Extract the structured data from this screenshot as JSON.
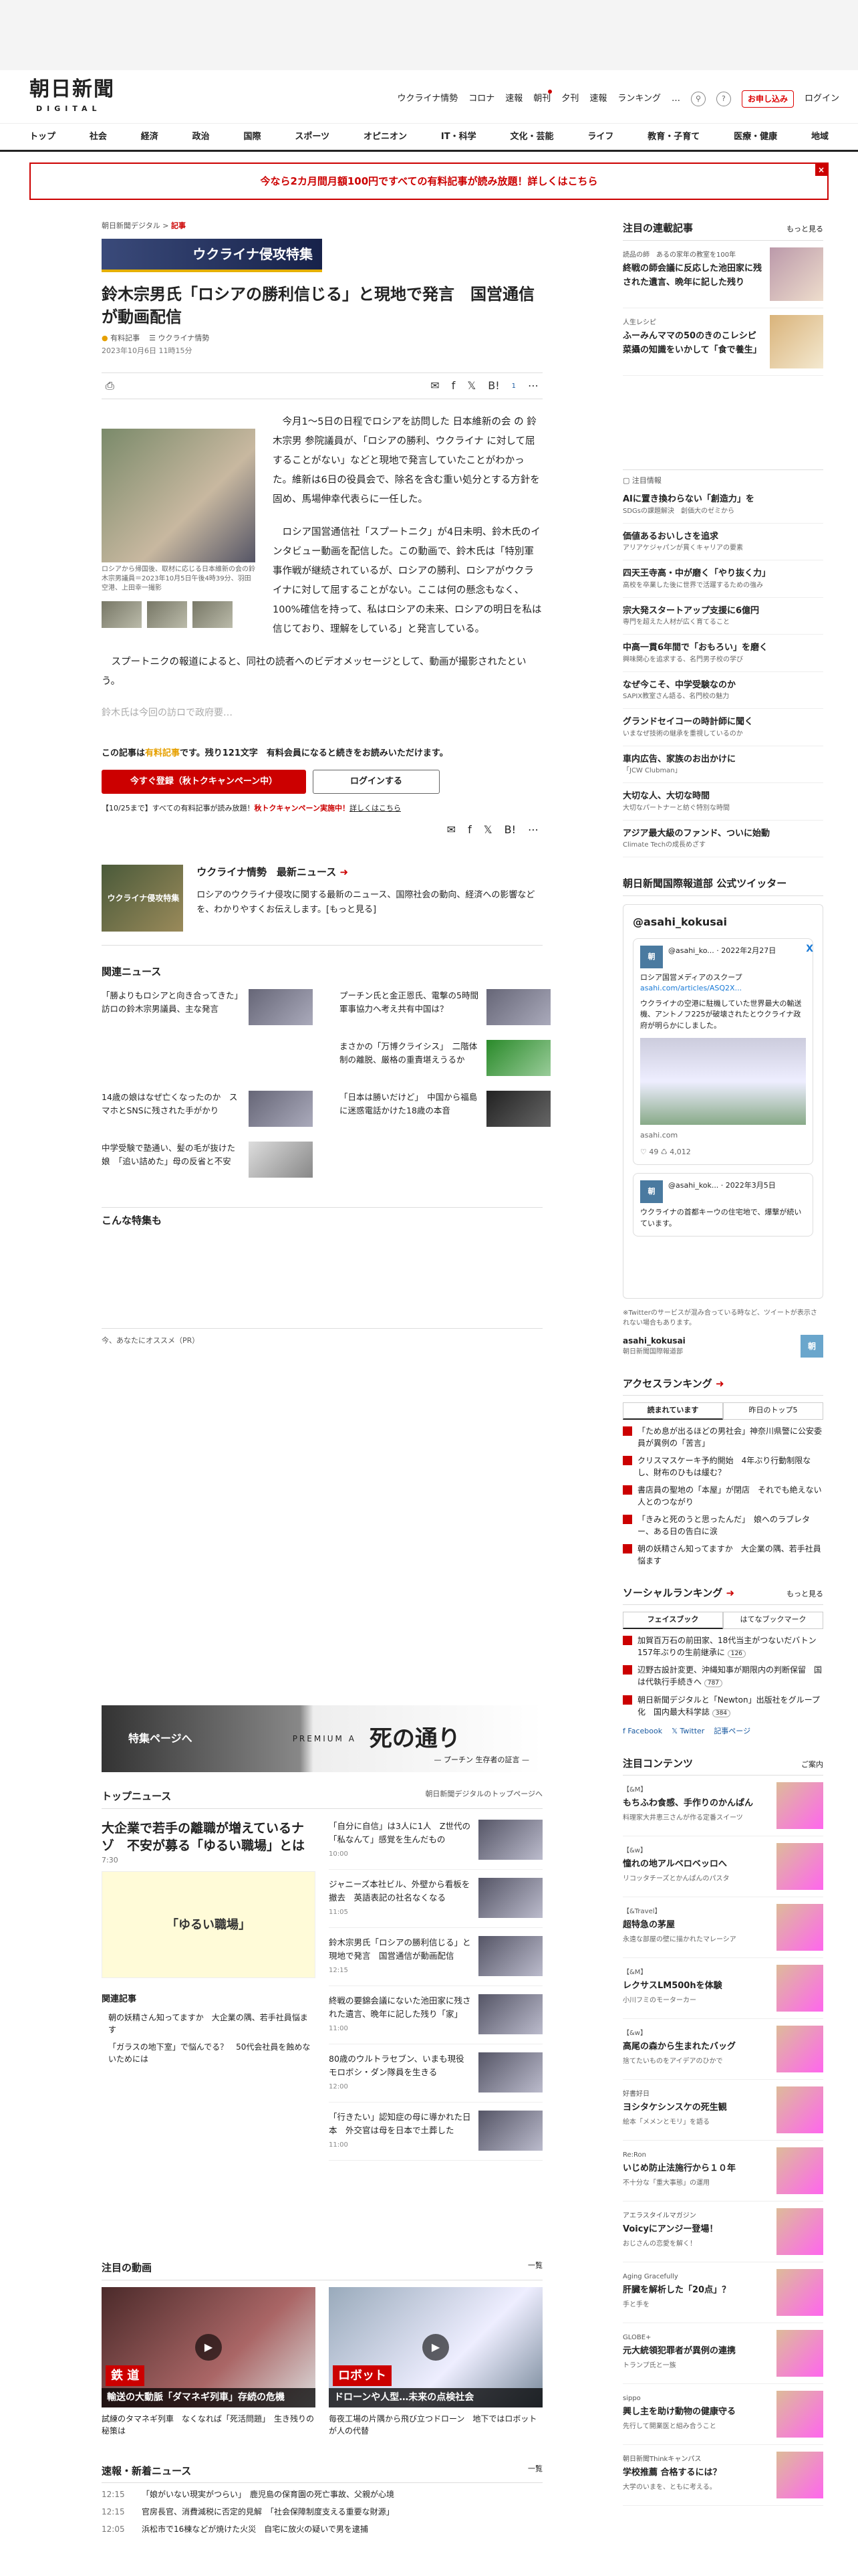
{
  "header": {
    "logo": "朝日新聞",
    "logo_sub": "DIGITAL",
    "nav": [
      "ウクライナ情勢",
      "コロナ",
      "速報",
      "朝刊",
      "夕刊",
      "速報",
      "ランキング"
    ],
    "more": "…",
    "signup": "お申し込み",
    "login": "ログイン"
  },
  "gnav": [
    "トップ",
    "社会",
    "経済",
    "政治",
    "国際",
    "スポーツ",
    "オピニオン",
    "IT・科学",
    "文化・芸能",
    "ライフ",
    "教育・子育て",
    "医療・健康",
    "地域"
  ],
  "banner": {
    "text": "今なら2カ月間月額100円ですべての有料記事が読み放題！詳しくはこちら",
    "close": "×"
  },
  "article": {
    "crumb_site": "朝日新聞デジタル",
    "crumb_sep": ">",
    "crumb_cat": "記事",
    "feature": "ウクライナ侵攻特集",
    "title": "鈴木宗男氏「ロシアの勝利信じる」と現地で発言　国営通信が動画配信",
    "paid": "有料記事",
    "series": "ウクライナ情勢",
    "date": "2023年10月6日 11時15分",
    "share_count": "1",
    "photo_caption": "ロシアから帰国後、取材に応じる日本維新の会の鈴木宗男議員＝2023年10月5日午後4時39分、羽田空港、上田幸一撮影",
    "paras": [
      "今月1～5日の日程でロシアを訪問した 日本維新の会 の 鈴木宗男 参院議員が、「ロシアの勝利、ウクライナ に対して屈することがない」などと現地で発言していたことがわかった。維新は6日の役員会で、除名を含む重い処分とする方針を固め、馬場伸幸代表らに一任した。",
      "ロシア国営通信社「スプートニク」が4日未明、鈴木氏のインタビュー動画を配信した。この動画で、鈴木氏は「特別軍事作戦が継続されているが、ロシアの勝利、ロシアがウクライナに対して屈することがない。ここは何の懸念もなく、100%確信を持って、私はロシアの未来、ロシアの明日を私は信じており、理解をしている」と発言している。",
      "スプートニクの報道によると、同社の読者へのビデオメッセージとして、動画が撮影されたという。"
    ],
    "fade": "鈴木氏は今回の訪ロで政府要…",
    "pw_prefix": "この記事は",
    "pw_paid": "有料記事",
    "pw_suffix": "です。残り121文字　有料会員になると続きをお読みいただけます。",
    "pw_btn1": "今すぐ登録（秋トクキャンペーン中）",
    "pw_btn2": "ログインする",
    "pw_note_a": "【10/25まで】すべての有料記事が読み放題！",
    "pw_note_b": "秋トクキャンペーン実施中！",
    "pw_note_c": "詳しくはこちら"
  },
  "ukraine": {
    "title": "ウクライナ情勢　最新ニュース",
    "desc": "ロシアのウクライナ侵攻に関する最新のニュース、国際社会の動向、経済への影響などを、わかりやすくお伝えします。",
    "more": "[もっと見る]",
    "img_label": "ウクライナ侵攻特集"
  },
  "related": {
    "heading": "関連ニュース",
    "items": [
      "「勝よりもロシアと向き合ってきた」　訪ロの鈴木宗男議員、主な発言",
      "プーチン氏と金正恩氏、電撃の5時間　軍事協力へ考え共有中国は？",
      "",
      "まさかの「万博クライシス」　二階体制の離脱、厳格の重責堪えうるか",
      "14歳の娘はなぜ亡くなったのか　スマホとSNSに残された手がかり",
      "「日本は勝いだけど」　中国から福島に迷惑電話かけた18歳の本音",
      "中学受験で塾通い、髪の毛が抜けた娘　「追い詰めた」母の反省と不安",
      ""
    ]
  },
  "konna": "こんな特集も",
  "pr": "今、あなたにオススメ（PR）",
  "deathbanner": {
    "left": "特集ページへ",
    "premium": "PREMIUM A",
    "title": "死の通り",
    "sub": "— プーチン 生存者の証言 —"
  },
  "topnews": {
    "heading": "トップニュース",
    "more": "朝日新聞デジタルのトップページへ",
    "lead_title": "大企業で若手の離職が増えているナゾ　不安が募る「ゆるい職場」とは",
    "lead_time": "7:30",
    "illus": "「ゆるい職場」",
    "rel_h": "関連記事",
    "rel": [
      "朝の妖精さん知ってますか　大企業の隅、若手社員悩ます",
      "「ガラスの地下室」で悩んでる？　50代会社員を蝕めないためには"
    ],
    "items": [
      {
        "t": "「自分に自信」は3人に1人　Z世代の「私なんて」感覚を生んだもの",
        "tm": "10:00"
      },
      {
        "t": "ジャニーズ本社ビル、外壁から看板を撤去　英語表記の社名なくなる",
        "tm": "11:05"
      },
      {
        "t": "鈴木宗男氏「ロシアの勝利信じる」と現地で発言　国営通信が動画配信",
        "tm": "12:15"
      },
      {
        "t": "終戦の要錦会議にないた池田家に残された遺言、晩年に記した残り「家」",
        "tm": "11:00"
      },
      {
        "t": "80歳のウルトラセブン、いまも現役　モロボシ・ダン隊員を生きる",
        "tm": "12:00"
      },
      {
        "t": "「行きたい」認知症の母に導かれた日本　外交官は母を日本で土葬した",
        "tm": "11:00"
      }
    ]
  },
  "videos": {
    "heading": "注目の動画",
    "more": "一覧",
    "items": [
      {
        "lab": "鉄 道",
        "sub": "輸送の大動脈「ダマネギ列車」存続の危機",
        "cap": "試練のタマネギ列車　なくなれば「死活問題」　生き残りの秘策は"
      },
      {
        "lab": "ロボット",
        "sub": "ドローンや人型…未来の点検社会",
        "cap": "毎夜工場の片隅から飛び立つドローン　地下ではロボットが人の代替"
      }
    ]
  },
  "breaking": {
    "heading": "速報・新着ニュース",
    "more": "一覧",
    "items": [
      {
        "tm": "12:15",
        "t": "「娘がいない現実がつらい」　鹿児島の保育園の死亡事故、父親が心境"
      },
      {
        "tm": "12:15",
        "t": "官房長官、消費減税に否定的見解　「社会保障制度支える重要な財源」"
      },
      {
        "tm": "12:05",
        "t": "浜松市で16棟などが焼けた火災　自宅に放火の疑いで男を逮捕"
      }
    ]
  },
  "side": {
    "series_h": "注目の連載記事",
    "more": "もっと見る",
    "series": [
      {
        "k": "読品の師　あるの家年の教室を100年",
        "t": "終戦の師会議に反応した池田家に残された遺言、晩年に記した残り"
      },
      {
        "k": "人生レシピ",
        "t": "ふーみんママの50のきのこレシピ　菜攝の知識をいかして「食で養生」"
      }
    ],
    "pick_h": "注目情報",
    "picks": [
      {
        "t": "AIに置き換わらない「創造力」を",
        "s": "SDGsの課題解決　創価大のゼミから"
      },
      {
        "t": "価値あるおいしさを追求",
        "s": "アリアケジャパンが貫くキャリアの要素"
      },
      {
        "t": "四天王寺高・中が磨く「やり抜く力」",
        "s": "高校を卒業した後に世界で活躍するための強み"
      },
      {
        "t": "宗大発スタートアップ支援に6億円",
        "s": "専門を超えた人材が広く育てること"
      },
      {
        "t": "中高一貫6年間で「おもろい」を磨く",
        "s": "興味関心を追求する、名門男子校の学び"
      },
      {
        "t": "なぜ今こそ、中学受験なのか",
        "s": "SAPIX教室さん語る、名門校の魅力"
      },
      {
        "t": "グランドセイコーの時計師に聞く",
        "s": "いまなぜ技術の継承を重視しているのか"
      },
      {
        "t": "車内広告、家族のお出かけに",
        "s": "「JCW Clubman」"
      },
      {
        "t": "大切な人、大切な時間",
        "s": "大切なパートナーと紡ぐ特別な時間"
      },
      {
        "t": "アジア最大級のファンド、ついに始動",
        "s": "Climate Techの成長めざす"
      }
    ],
    "tw_h": "朝日新聞国際報道部 公式ツイッター",
    "tw_name": "@asahi_kokusai",
    "tw_av": "朝",
    "tw_user": "@asahi_ko... · 2022年2月27日",
    "tw_text": "ロシア国営メディアのスクープ",
    "tw_link": "asahi.com/articles/ASQ2X...",
    "tw_body": "ウクライナの空港に駐機していた世界最大の輸送機、アントノフ225が破壊されたとウクライナ政府が明らかにしました。",
    "tw_site": "asahi.com",
    "tw_stat": "♡ 49  ♺ 4,012",
    "tw_user2": "@asahi_kok... · 2022年3月5日",
    "tw_body2": "ウクライナの首都キーウの住宅地で、爆撃が続いています。",
    "tw_x": "X",
    "tw_note": "※Twitterのサービスが混み合っている時など、ツイートが表示されない場合もあります。",
    "tw_acct": "asahi_kokusai",
    "tw_acct_s": "朝日新聞国際報道部",
    "tw_acct_b": "朝",
    "rank_h": "アクセスランキング",
    "rank_tab1": "読まれています",
    "rank_tab2": "昨日のトップ5",
    "rank": [
      "「ため息が出るほどの男社会」神奈川県警に公安委員が異例の「苦言」",
      "クリスマスケーキ予約開始　4年ぶり行動制限なし、財布のひもは緩む？",
      "書店員の聖地の「本屋」が閉店　それでも絶えない人とのつながり",
      "「きみと死のうと思ったんだ」　娘へのラブレター、ある日の告白に涙",
      "朝の妖精さん知ってますか　大企業の隅、若手社員悩ます"
    ],
    "social_h": "ソーシャルランキング",
    "social_tab1": "フェイスブック",
    "social_tab2": "はてなブックマーク",
    "social": [
      {
        "t": "加賀百万石の前田家、18代当主がつないだバトン　157年ぶりの生前継承に",
        "c": "126"
      },
      {
        "t": "辺野古設計変更、沖縄知事が期限内の判断保留　国は代執行手続きへ",
        "c": "787"
      },
      {
        "t": "朝日新聞デジタルと「Newton」出版社をグループ化　国内最大科学誌",
        "c": "384"
      }
    ],
    "soc_fb": "Facebook",
    "soc_tw": "Twitter",
    "soc_more": "記事ページ",
    "chu_h": "注目コンテンツ",
    "chu_more": "ご案内",
    "chu": [
      {
        "k": "【&M】",
        "t": "もちふわ食感、手作りのかんぱん",
        "s": "料理家大井恵三さんが作る定番スイーツ"
      },
      {
        "k": "【&w】",
        "t": "憧れの地アルベロベッロへ",
        "s": "リコッタチーズとかんぱんのパスタ"
      },
      {
        "k": "【&Travel】",
        "t": "超特急の茅屋",
        "s": "永遠な部屋の壁に描かれたマレーシア"
      },
      {
        "k": "【&M】",
        "t": "レクサスLM500hを体験",
        "s": "小川フミのモーターカー"
      },
      {
        "k": "【&w】",
        "t": "高尾の森から生まれたバッグ",
        "s": "捨てたいものをアイデアのひかで"
      },
      {
        "k": "好書好日",
        "t": "ヨシタケシンスケの死生観",
        "s": "絵本「メメンとモリ」を語る"
      },
      {
        "k": "Re:Ron",
        "t": "いじめ防止法施行から１０年",
        "s": "不十分な「重大事態」の運用"
      },
      {
        "k": "アエラスタイルマガジン",
        "t": "Voicyにアンジー登場！",
        "s": "おじさんの恋愛を解く！"
      },
      {
        "k": "Aging Gracefully",
        "t": "肝臓を解析した「20点」？",
        "s": "手と手を"
      },
      {
        "k": "GLOBE+",
        "t": "元大統領犯罪者が異例の連携",
        "s": "トランプ氏と一族"
      },
      {
        "k": "sippo",
        "t": "興し主を助け動物の健康守る",
        "s": "先行して開業医と組み合うこと"
      },
      {
        "k": "朝日新聞Thinkキャンパス",
        "t": "学校推薦 合格するには？",
        "s": "大学のいまを、ともに考える。"
      }
    ]
  },
  "colors": {
    "brand_red": "#cc0000",
    "accent_gold": "#e6a000"
  }
}
